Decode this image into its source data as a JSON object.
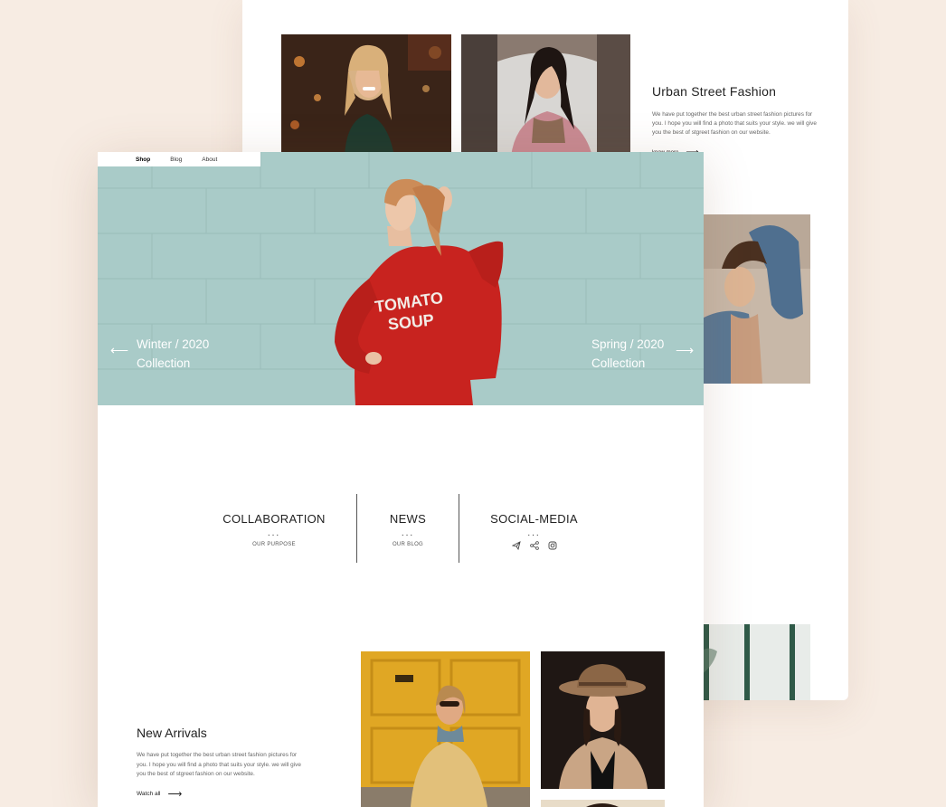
{
  "back_page": {
    "title": "Urban Street Fashion",
    "text": "We have put together the best urban street fashion pictures for you. I hope you will find a photo that suits your style. we will give you the best of stgreet fashion on our website.",
    "link": "know more",
    "link_icon": "arrow-right-icon"
  },
  "nav": {
    "items": [
      "Shop",
      "Blog",
      "About"
    ],
    "active": "Shop"
  },
  "hero": {
    "left_caption_line1": "Winter / 2020",
    "left_caption_line2": "Collection",
    "right_caption_line1": "Spring / 2020",
    "right_caption_line2": "Collection",
    "left_arrow": "⟵",
    "right_arrow": "⟶",
    "shirt_text_line1": "TOMATO",
    "shirt_text_line2": "SOUP"
  },
  "links": {
    "collaboration": {
      "title": "COLLABORATION",
      "dots": "...",
      "sub": "OUR PURPOSE"
    },
    "news": {
      "title": "NEWS",
      "dots": "...",
      "sub": "OUR BLOG"
    },
    "social": {
      "title": "SOCIAL-MEDIA",
      "dots": "...",
      "icons": [
        "telegram-icon",
        "share-icon",
        "instagram-icon"
      ]
    }
  },
  "new_arrivals": {
    "title": "New Arrivals",
    "text": "We have put together the best urban street fashion pictures for you. I hope you will find a photo that suits your style. we will give you the best of stgreet fashion on our website.",
    "link": "Watch all",
    "link_icon": "arrow-right-icon"
  },
  "colors": {
    "background": "#f7ece3",
    "hero_bg": "#a9cbc8",
    "sweater_red": "#c8231f",
    "door_yellow": "#e0a724"
  }
}
